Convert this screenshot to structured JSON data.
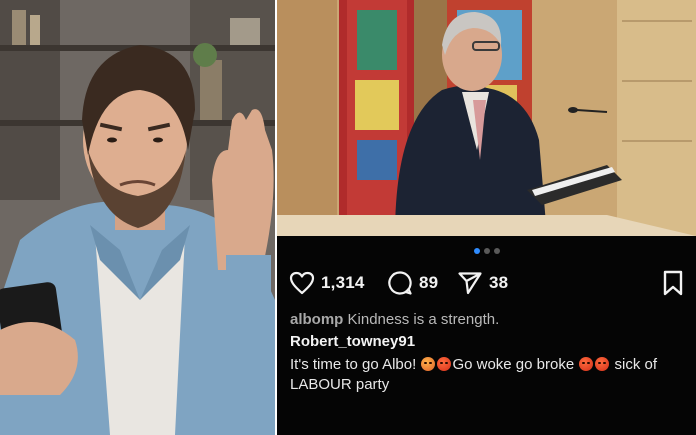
{
  "post": {
    "pagination": {
      "count": 3,
      "active": 0
    },
    "likes": "1,314",
    "comments": "89",
    "shares": "38",
    "caption": {
      "user": "albomp",
      "text": "Kindness is a strength."
    }
  },
  "comment": {
    "user": "Robert_towney91",
    "part1": "It's time to go Albo! ",
    "part2": "Go woke go broke ",
    "part3": " sick of LABOUR party"
  },
  "icons": [
    "heart-icon",
    "comment-icon",
    "share-icon",
    "bookmark-icon",
    "angry-face-icon"
  ],
  "colors": {
    "background": "#050505",
    "dot_active": "#2f8cff",
    "text": "#f2f2f2"
  }
}
